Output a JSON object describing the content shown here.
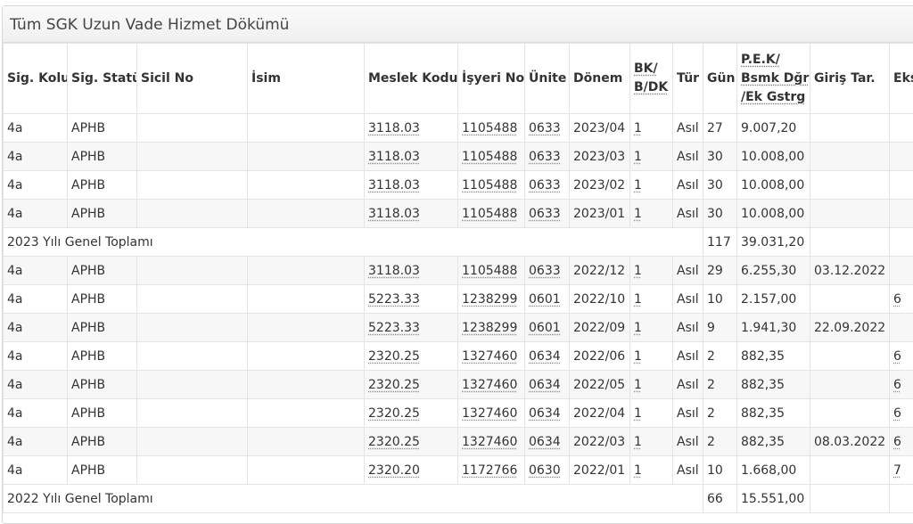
{
  "panel": {
    "title": "Tüm SGK Uzun Vade Hizmet Dökümü"
  },
  "table": {
    "headers": [
      "Sig. Kolu",
      "Sig. Statü",
      "Sicil No",
      "İsim",
      "Meslek Kodu",
      "İşyeri No",
      "Ünite",
      "Dönem",
      "BK/\nB/DK",
      "Tür",
      "Gün",
      "P.E.K/\nBsmk Dğr\n/Ek Gstrg",
      "Giriş Tar.",
      "Eks"
    ],
    "rows": [
      {
        "kolu": "4a",
        "statu": "APHB",
        "sicil": "",
        "isim": "",
        "meslek": "3118.03",
        "isyeri": "1105488",
        "unite": "0633",
        "donem": "2023/04",
        "bk": "1",
        "tur": "Asıl",
        "gun": "27",
        "pek": "9.007,20",
        "giris": "",
        "eks": ""
      },
      {
        "kolu": "4a",
        "statu": "APHB",
        "sicil": "",
        "isim": "",
        "meslek": "3118.03",
        "isyeri": "1105488",
        "unite": "0633",
        "donem": "2023/03",
        "bk": "1",
        "tur": "Asıl",
        "gun": "30",
        "pek": "10.008,00",
        "giris": "",
        "eks": ""
      },
      {
        "kolu": "4a",
        "statu": "APHB",
        "sicil": "",
        "isim": "",
        "meslek": "3118.03",
        "isyeri": "1105488",
        "unite": "0633",
        "donem": "2023/02",
        "bk": "1",
        "tur": "Asıl",
        "gun": "30",
        "pek": "10.008,00",
        "giris": "",
        "eks": ""
      },
      {
        "kolu": "4a",
        "statu": "APHB",
        "sicil": "",
        "isim": "",
        "meslek": "3118.03",
        "isyeri": "1105488",
        "unite": "0633",
        "donem": "2023/01",
        "bk": "1",
        "tur": "Asıl",
        "gun": "30",
        "pek": "10.008,00",
        "giris": "",
        "eks": ""
      },
      {
        "total": true,
        "label": "2023 Yılı Genel Toplamı",
        "gun": "117",
        "pek": "39.031,20"
      },
      {
        "kolu": "4a",
        "statu": "APHB",
        "sicil": "",
        "isim": "",
        "meslek": "3118.03",
        "isyeri": "1105488",
        "unite": "0633",
        "donem": "2022/12",
        "bk": "1",
        "tur": "Asıl",
        "gun": "29",
        "pek": "6.255,30",
        "giris": "03.12.2022",
        "eks": ""
      },
      {
        "kolu": "4a",
        "statu": "APHB",
        "sicil": "",
        "isim": "",
        "meslek": "5223.33",
        "isyeri": "1238299",
        "unite": "0601",
        "donem": "2022/10",
        "bk": "1",
        "tur": "Asıl",
        "gun": "10",
        "pek": "2.157,00",
        "giris": "",
        "eks": "6"
      },
      {
        "kolu": "4a",
        "statu": "APHB",
        "sicil": "",
        "isim": "",
        "meslek": "5223.33",
        "isyeri": "1238299",
        "unite": "0601",
        "donem": "2022/09",
        "bk": "1",
        "tur": "Asıl",
        "gun": "9",
        "pek": "1.941,30",
        "giris": "22.09.2022",
        "eks": ""
      },
      {
        "kolu": "4a",
        "statu": "APHB",
        "sicil": "",
        "isim": "",
        "meslek": "2320.25",
        "isyeri": "1327460",
        "unite": "0634",
        "donem": "2022/06",
        "bk": "1",
        "tur": "Asıl",
        "gun": "2",
        "pek": "882,35",
        "giris": "",
        "eks": "6"
      },
      {
        "kolu": "4a",
        "statu": "APHB",
        "sicil": "",
        "isim": "",
        "meslek": "2320.25",
        "isyeri": "1327460",
        "unite": "0634",
        "donem": "2022/05",
        "bk": "1",
        "tur": "Asıl",
        "gun": "2",
        "pek": "882,35",
        "giris": "",
        "eks": "6"
      },
      {
        "kolu": "4a",
        "statu": "APHB",
        "sicil": "",
        "isim": "",
        "meslek": "2320.25",
        "isyeri": "1327460",
        "unite": "0634",
        "donem": "2022/04",
        "bk": "1",
        "tur": "Asıl",
        "gun": "2",
        "pek": "882,35",
        "giris": "",
        "eks": "6"
      },
      {
        "kolu": "4a",
        "statu": "APHB",
        "sicil": "",
        "isim": "",
        "meslek": "2320.25",
        "isyeri": "1327460",
        "unite": "0634",
        "donem": "2022/03",
        "bk": "1",
        "tur": "Asıl",
        "gun": "2",
        "pek": "882,35",
        "giris": "08.03.2022",
        "eks": "6"
      },
      {
        "kolu": "4a",
        "statu": "APHB",
        "sicil": "",
        "isim": "",
        "meslek": "2320.20",
        "isyeri": "1172766",
        "unite": "0630",
        "donem": "2022/01",
        "bk": "1",
        "tur": "Asıl",
        "gun": "10",
        "pek": "1.668,00",
        "giris": "",
        "eks": "7"
      },
      {
        "total": true,
        "label": "2022 Yılı Genel Toplamı",
        "gun": "66",
        "pek": "15.551,00"
      }
    ]
  }
}
